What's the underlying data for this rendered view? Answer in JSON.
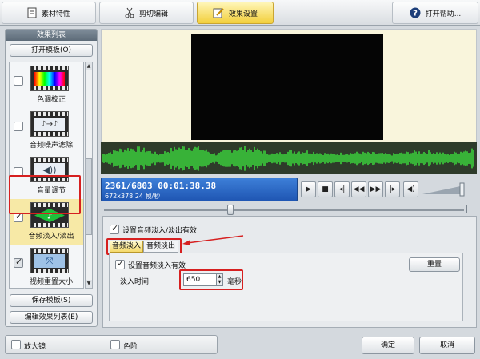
{
  "toolbar": {
    "tabs": [
      {
        "label": "素材特性",
        "icon": "document-icon"
      },
      {
        "label": "剪切编辑",
        "icon": "scissors-icon"
      },
      {
        "label": "效果设置",
        "icon": "edit-icon",
        "active": true
      },
      {
        "label": "打开帮助...",
        "icon": "help-icon"
      }
    ]
  },
  "left_panel": {
    "title": "效果列表",
    "open_template": "打开模板(O)",
    "effects": [
      {
        "label": "色调校正",
        "checked": false,
        "icon": "color-spectrum-icon"
      },
      {
        "label": "音频噪声滤除",
        "checked": false,
        "icon": "audio-filter-icon"
      },
      {
        "label": "音量调节",
        "checked": false,
        "icon": "speaker-icon"
      },
      {
        "label": "音频淡入/淡出",
        "checked": true,
        "icon": "audio-fade-icon"
      },
      {
        "label": "视频重置大小",
        "checked": true,
        "icon": "resize-icon"
      }
    ],
    "save_template": "保存模板(S)",
    "edit_list": "编辑效果列表(E)"
  },
  "player": {
    "timecode": "2361/6803  00:01:38.38",
    "info": "672x378 24  帧/秒",
    "position_fraction": 0.35
  },
  "settings": {
    "enable_label": "设置音频淡入/淡出有效",
    "enable_checked": true,
    "tabs": [
      "音频淡入",
      "音频淡出"
    ],
    "fade_in_enable_label": "设置音频淡入有效",
    "fade_in_enable_checked": true,
    "reset_label": "重置",
    "fade_time_label": "淡入时间:",
    "fade_time_value": "650",
    "unit_label": "毫秒"
  },
  "bottom": {
    "magnifier_label": "放大镜",
    "levels_label": "色阶",
    "ok_label": "确定",
    "cancel_label": "取消"
  },
  "colors": {
    "waveform": "#3ee63e",
    "highlight": "#d62020",
    "timecode_bg": "#2a66c4"
  }
}
